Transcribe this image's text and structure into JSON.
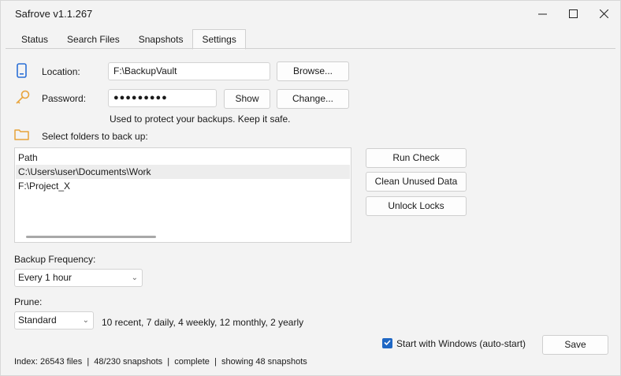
{
  "window": {
    "title": "Safrove v1.1.267",
    "minimize_glyph": "—",
    "maximize_glyph": "☐",
    "close_glyph": "✕"
  },
  "tabs": [
    {
      "label": "Status"
    },
    {
      "label": "Search Files"
    },
    {
      "label": "Snapshots"
    },
    {
      "label": "Settings",
      "active": true
    }
  ],
  "location": {
    "icon": "phone-storage-icon",
    "label": "Location:",
    "value": "F:\\BackupVault",
    "browse_label": "Browse..."
  },
  "password": {
    "icon": "key-icon",
    "label": "Password:",
    "value": "●●●●●●●●●",
    "show_label": "Show",
    "change_label": "Change...",
    "hint": "Used to protect your backups. Keep it safe."
  },
  "folders": {
    "icon": "folder-icon",
    "label": "Select folders to back up:",
    "column_header": "Path",
    "rows": [
      "C:\\Users\\user\\Documents\\Work",
      "F:\\Project_X"
    ]
  },
  "actions": {
    "run_check": "Run Check",
    "clean_unused": "Clean Unused Data",
    "unlock_locks": "Unlock Locks"
  },
  "frequency": {
    "label": "Backup Frequency:",
    "value": "Every 1 hour"
  },
  "prune": {
    "label": "Prune:",
    "value": "Standard",
    "description": "10 recent, 7 daily, 4 weekly, 12 monthly, 2 yearly"
  },
  "autostart": {
    "label": "Start with Windows (auto-start)",
    "checked": true
  },
  "save_label": "Save",
  "status_bar": "Index: 26543 files  |  48/230 snapshots  |  complete  |  showing 48 snapshots",
  "colors": {
    "accent": "#1f67c4",
    "icon_orange": "#e8a33a",
    "icon_blue": "#2b6fd6"
  }
}
